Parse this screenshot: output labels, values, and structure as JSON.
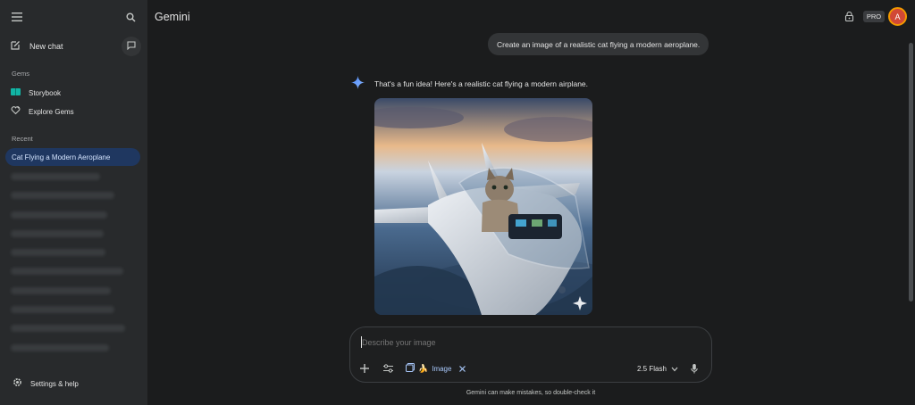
{
  "app": {
    "title": "Gemini",
    "pro_badge": "PRO",
    "avatar_letter": "A"
  },
  "sidebar": {
    "new_chat_label": "New chat",
    "gems_heading": "Gems",
    "gems": [
      {
        "label": "Storybook",
        "icon": "book-icon"
      },
      {
        "label": "Explore Gems",
        "icon": "gem-heart-icon"
      }
    ],
    "recent_heading": "Recent",
    "active_chat": "Cat Flying a Modern Aeroplane",
    "settings_label": "Settings & help"
  },
  "chat": {
    "user_prompt": "Create an image of a realistic cat flying a modern aeroplane.",
    "reply_text": "That's a fun idea! Here's a realistic cat flying a modern airplane."
  },
  "composer": {
    "placeholder": "Describe your image",
    "image_chip_emoji": "🍌",
    "image_chip_label": "Image",
    "model_label": "2.5 Flash",
    "disclaimer": "Gemini can make mistakes, so double-check it"
  },
  "colors": {
    "background": "#1b1c1d",
    "sidebar": "#282a2c",
    "active_chat": "#1f3760",
    "accent_blue": "#a8c7fa"
  }
}
